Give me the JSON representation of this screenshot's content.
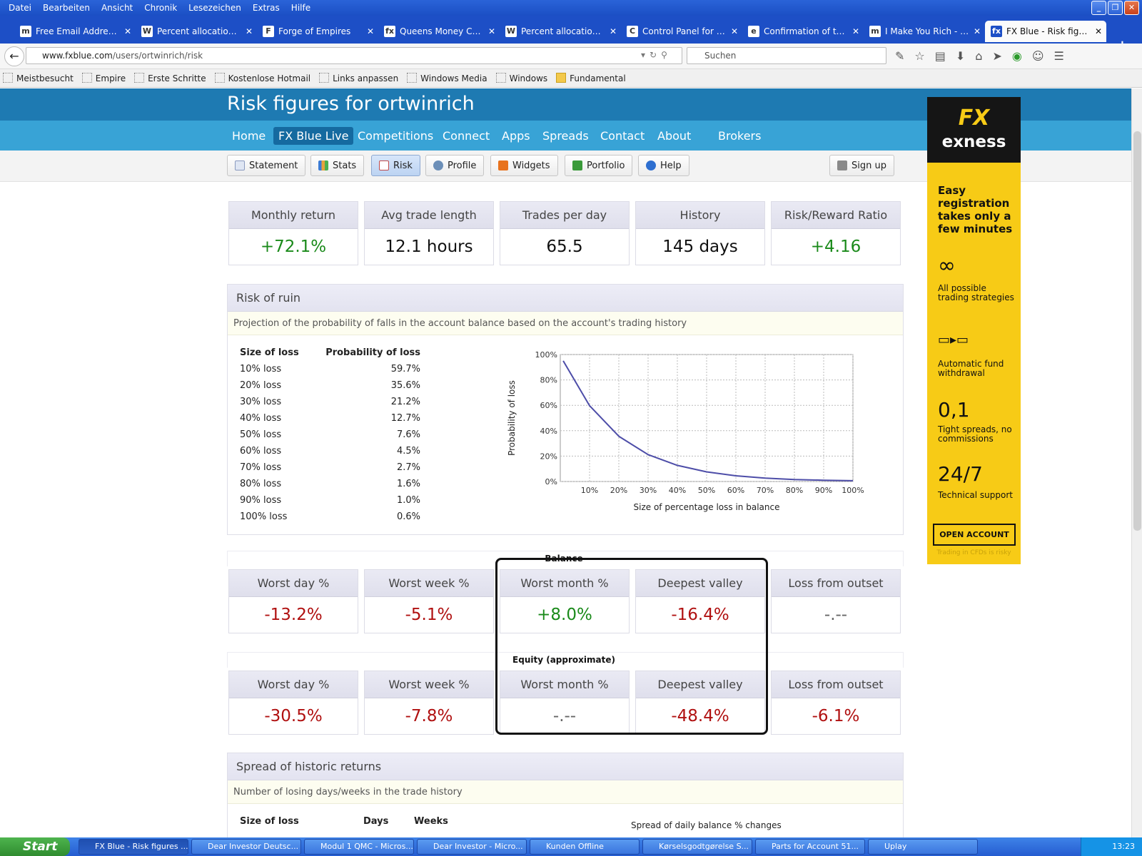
{
  "browser": {
    "menu": [
      "Datei",
      "Bearbeiten",
      "Ansicht",
      "Chronik",
      "Lesezeichen",
      "Extras",
      "Hilfe"
    ],
    "tabs": [
      {
        "label": "Free Email Addresses...",
        "icon": "m"
      },
      {
        "label": "Percent allocation ma...",
        "icon": "W"
      },
      {
        "label": "Forge of Empires",
        "icon": "F"
      },
      {
        "label": "Queens Money Collec...",
        "icon": "fx"
      },
      {
        "label": "Percent allocation ma...",
        "icon": "W"
      },
      {
        "label": "Control Panel for Sig...",
        "icon": "C"
      },
      {
        "label": "Confirmation of the a...",
        "icon": "e"
      },
      {
        "label": "I Make You Rich - Home",
        "icon": "m"
      },
      {
        "label": "FX Blue - Risk figures ...",
        "icon": "fx",
        "active": true
      }
    ],
    "url_domain": "www.fxblue.com",
    "url_path": "/users/ortwinrich/risk",
    "search_placeholder": "Suchen",
    "bookmarks": [
      "Meistbesucht",
      "Empire",
      "Erste Schritte",
      "Kostenlose Hotmail",
      "Links anpassen",
      "Windows Media",
      "Windows",
      "Fundamental"
    ]
  },
  "page": {
    "title": "Risk figures for ortwinrich",
    "nav": [
      "Home",
      "FX Blue Live",
      "Competitions",
      "Connect",
      "Apps",
      "Spreads",
      "Contact",
      "About",
      "Brokers"
    ],
    "subnav": [
      "Statement",
      "Stats",
      "Risk",
      "Profile",
      "Widgets",
      "Portfolio",
      "Help"
    ],
    "signup": "Sign up",
    "summary": [
      {
        "label": "Monthly return",
        "value": "+72.1%",
        "tone": "pos"
      },
      {
        "label": "Avg trade length",
        "value": "12.1 hours",
        "tone": ""
      },
      {
        "label": "Trades per day",
        "value": "65.5",
        "tone": ""
      },
      {
        "label": "History",
        "value": "145 days",
        "tone": ""
      },
      {
        "label": "Risk/Reward Ratio",
        "value": "+4.16",
        "tone": "pos"
      }
    ],
    "risk_of_ruin": {
      "title": "Risk of ruin",
      "desc": "Projection of the probability of falls in the account balance based on the account's trading history",
      "col_size": "Size of loss",
      "col_prob": "Probability of loss",
      "rows": [
        [
          "10% loss",
          "59.7%"
        ],
        [
          "20% loss",
          "35.6%"
        ],
        [
          "30% loss",
          "21.2%"
        ],
        [
          "40% loss",
          "12.7%"
        ],
        [
          "50% loss",
          "7.6%"
        ],
        [
          "60% loss",
          "4.5%"
        ],
        [
          "70% loss",
          "2.7%"
        ],
        [
          "80% loss",
          "1.6%"
        ],
        [
          "90% loss",
          "1.0%"
        ],
        [
          "100% loss",
          "0.6%"
        ]
      ]
    },
    "balance": {
      "caption": "Balance",
      "boxes": [
        {
          "label": "Worst day %",
          "value": "-13.2%",
          "tone": "neg"
        },
        {
          "label": "Worst week %",
          "value": "-5.1%",
          "tone": "neg"
        },
        {
          "label": "Worst month %",
          "value": "+8.0%",
          "tone": "pos"
        },
        {
          "label": "Deepest valley",
          "value": "-16.4%",
          "tone": "neg"
        },
        {
          "label": "Loss from outset",
          "value": "-.--",
          "tone": "dash"
        }
      ]
    },
    "equity": {
      "caption": "Equity (approximate)",
      "boxes": [
        {
          "label": "Worst day %",
          "value": "-30.5%",
          "tone": "neg"
        },
        {
          "label": "Worst week %",
          "value": "-7.8%",
          "tone": "neg"
        },
        {
          "label": "Worst month %",
          "value": "-.--",
          "tone": "dash"
        },
        {
          "label": "Deepest valley",
          "value": "-48.4%",
          "tone": "neg"
        },
        {
          "label": "Loss from outset",
          "value": "-6.1%",
          "tone": "neg"
        }
      ]
    },
    "historic": {
      "title": "Spread of historic returns",
      "desc": "Number of losing days/weeks in the trade history",
      "col_size": "Size of loss",
      "col_days": "Days",
      "col_weeks": "Weeks",
      "chart_title": "Spread of daily balance % changes"
    }
  },
  "chart_data": {
    "type": "line",
    "xlabel": "Size of percentage loss in balance",
    "ylabel": "Probability of loss",
    "x_ticks": [
      "10%",
      "20%",
      "30%",
      "40%",
      "50%",
      "60%",
      "70%",
      "80%",
      "90%",
      "100%"
    ],
    "y_ticks": [
      "0%",
      "20%",
      "40%",
      "60%",
      "80%",
      "100%"
    ],
    "xlim": [
      0,
      100
    ],
    "ylim": [
      0,
      100
    ],
    "grid": true,
    "x": [
      1,
      10,
      20,
      30,
      40,
      50,
      60,
      70,
      80,
      90,
      100
    ],
    "y": [
      95,
      59.7,
      35.6,
      21.2,
      12.7,
      7.6,
      4.5,
      2.7,
      1.6,
      1.0,
      0.6
    ]
  },
  "ad": {
    "brand_mark": "FX",
    "brand": "exness",
    "headline": "Easy registration takes only a few minutes",
    "f1_icon": "∞",
    "f1": "All possible trading strategies",
    "f2": "Automatic fund withdrawal",
    "f3_big": "0,1",
    "f3": "Tight spreads, no commissions",
    "f4_big": "24/7",
    "f4": "Technical support",
    "button": "OPEN ACCOUNT",
    "footer": "Trading in CFDs is risky"
  },
  "taskbar": {
    "start": "Start",
    "items": [
      "FX Blue - Risk figures ...",
      "Dear Investor Deutsc...",
      "Modul 1 QMC - Micros...",
      "Dear Investor - Micro...",
      "Kunden Offline",
      "Kørselsgodtgørelse S...",
      "Parts for Account 51...",
      "Uplay"
    ],
    "clock": "13:23"
  },
  "colors": {
    "header": "#1e7ab2",
    "nav": "#38a3d6",
    "positive": "#1a8a1a",
    "negative": "#b01010",
    "curve": "#4d4da8",
    "ad": "#f7cb16"
  }
}
